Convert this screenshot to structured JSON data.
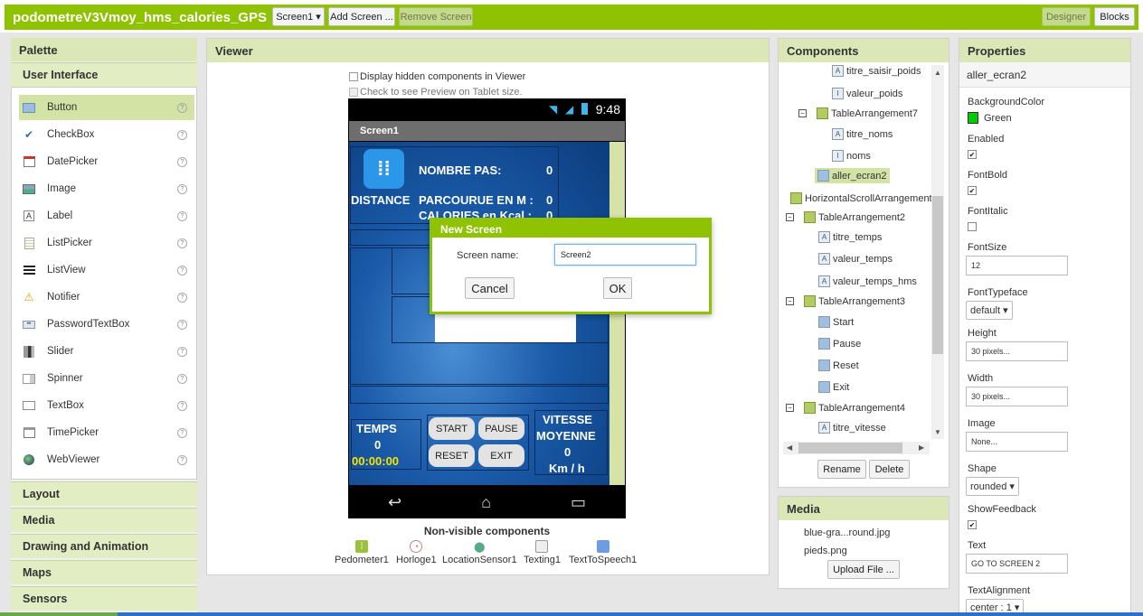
{
  "topbar": {
    "project_title": "podometreV3Vmoy_hms_calories_GPS",
    "screen_dropdown": "Screen1 ▾",
    "add_screen": "Add Screen ...",
    "remove_screen": "Remove Screen",
    "designer": "Designer",
    "blocks": "Blocks"
  },
  "palette": {
    "title": "Palette",
    "category_open": "User Interface",
    "items": [
      {
        "label": "Button",
        "icon": "button-icon"
      },
      {
        "label": "CheckBox",
        "icon": "checkbox-icon"
      },
      {
        "label": "DatePicker",
        "icon": "datepicker-icon"
      },
      {
        "label": "Image",
        "icon": "image-icon"
      },
      {
        "label": "Label",
        "icon": "label-icon"
      },
      {
        "label": "ListPicker",
        "icon": "listpicker-icon"
      },
      {
        "label": "ListView",
        "icon": "listview-icon"
      },
      {
        "label": "Notifier",
        "icon": "notifier-icon"
      },
      {
        "label": "PasswordTextBox",
        "icon": "password-icon"
      },
      {
        "label": "Slider",
        "icon": "slider-icon"
      },
      {
        "label": "Spinner",
        "icon": "spinner-icon"
      },
      {
        "label": "TextBox",
        "icon": "textbox-icon"
      },
      {
        "label": "TimePicker",
        "icon": "timepicker-icon"
      },
      {
        "label": "WebViewer",
        "icon": "webviewer-icon"
      }
    ],
    "categories": [
      "Layout",
      "Media",
      "Drawing and Animation",
      "Maps",
      "Sensors"
    ]
  },
  "viewer": {
    "title": "Viewer",
    "display_hidden": "Display hidden components in Viewer",
    "tablet_preview": "Check to see Preview on Tablet size.",
    "phone": {
      "time": "9:48",
      "screen_title": "Screen1",
      "nombre_pas_label": "NOMBRE PAS:",
      "nombre_pas_value": "0",
      "distance_label": "DISTANCE",
      "parcourue_label": "PARCOURUE EN M :",
      "parcourue_value": "0",
      "calories_label": "CALORIES en Kcal :",
      "calories_value": "0",
      "temps_label": "TEMPS",
      "temps_value": "0",
      "temps_clock": "00:00:00",
      "start": "START",
      "pause": "PAUSE",
      "reset": "RESET",
      "exit": "EXIT",
      "vitesse": "VITESSE",
      "moyenne": "MOYENNE",
      "vitesse_value": "0",
      "vitesse_unit": "Km / h"
    },
    "nonvisible_title": "Non-visible components",
    "nonvisible": [
      {
        "label": "Pedometer1",
        "icon": "pedometer-icon"
      },
      {
        "label": "Horloge1",
        "icon": "clock-icon"
      },
      {
        "label": "LocationSensor1",
        "icon": "location-icon"
      },
      {
        "label": "Texting1",
        "icon": "texting-icon"
      },
      {
        "label": "TextToSpeech1",
        "icon": "speech-icon"
      }
    ]
  },
  "dialog": {
    "title": "New Screen",
    "field_label": "Screen name:",
    "field_value": "Screen2",
    "cancel": "Cancel",
    "ok": "OK"
  },
  "components": {
    "title": "Components",
    "tree": [
      {
        "label": "titre_saisir_poids",
        "type": "label"
      },
      {
        "label": "valeur_poids",
        "type": "textbox"
      },
      {
        "label": "TableArrangement7",
        "type": "arrangement"
      },
      {
        "label": "titre_noms",
        "type": "label"
      },
      {
        "label": "noms",
        "type": "textbox"
      },
      {
        "label": "aller_ecran2",
        "type": "button"
      },
      {
        "label": "HorizontalScrollArrangement",
        "type": "arrangement"
      },
      {
        "label": "TableArrangement2",
        "type": "arrangement"
      },
      {
        "label": "titre_temps",
        "type": "label"
      },
      {
        "label": "valeur_temps",
        "type": "label"
      },
      {
        "label": "valeur_temps_hms",
        "type": "label"
      },
      {
        "label": "TableArrangement3",
        "type": "arrangement"
      },
      {
        "label": "Start",
        "type": "button"
      },
      {
        "label": "Pause",
        "type": "button"
      },
      {
        "label": "Reset",
        "type": "button"
      },
      {
        "label": "Exit",
        "type": "button"
      },
      {
        "label": "TableArrangement4",
        "type": "arrangement"
      },
      {
        "label": "titre_vitesse",
        "type": "label"
      }
    ],
    "rename": "Rename",
    "delete": "Delete"
  },
  "media": {
    "title": "Media",
    "files": [
      "blue-gra...round.jpg",
      "pieds.png"
    ],
    "upload": "Upload File ..."
  },
  "properties": {
    "title": "Properties",
    "component": "aller_ecran2",
    "background_color_label": "BackgroundColor",
    "background_color_value": "Green",
    "background_color_hex": "#00cc00",
    "enabled_label": "Enabled",
    "fontbold_label": "FontBold",
    "fontitalic_label": "FontItalic",
    "fontsize_label": "FontSize",
    "fontsize_value": "12",
    "fonttypeface_label": "FontTypeface",
    "fonttypeface_value": "default ▾",
    "height_label": "Height",
    "height_value": "30 pixels...",
    "width_label": "Width",
    "width_value": "30 pixels...",
    "image_label": "Image",
    "image_value": "None...",
    "shape_label": "Shape",
    "shape_value": "rounded ▾",
    "showfeedback_label": "ShowFeedback",
    "text_label": "Text",
    "text_value": "GO TO SCREEN 2",
    "textalignment_label": "TextAlignment",
    "textalignment_value": "center : 1 ▾"
  }
}
